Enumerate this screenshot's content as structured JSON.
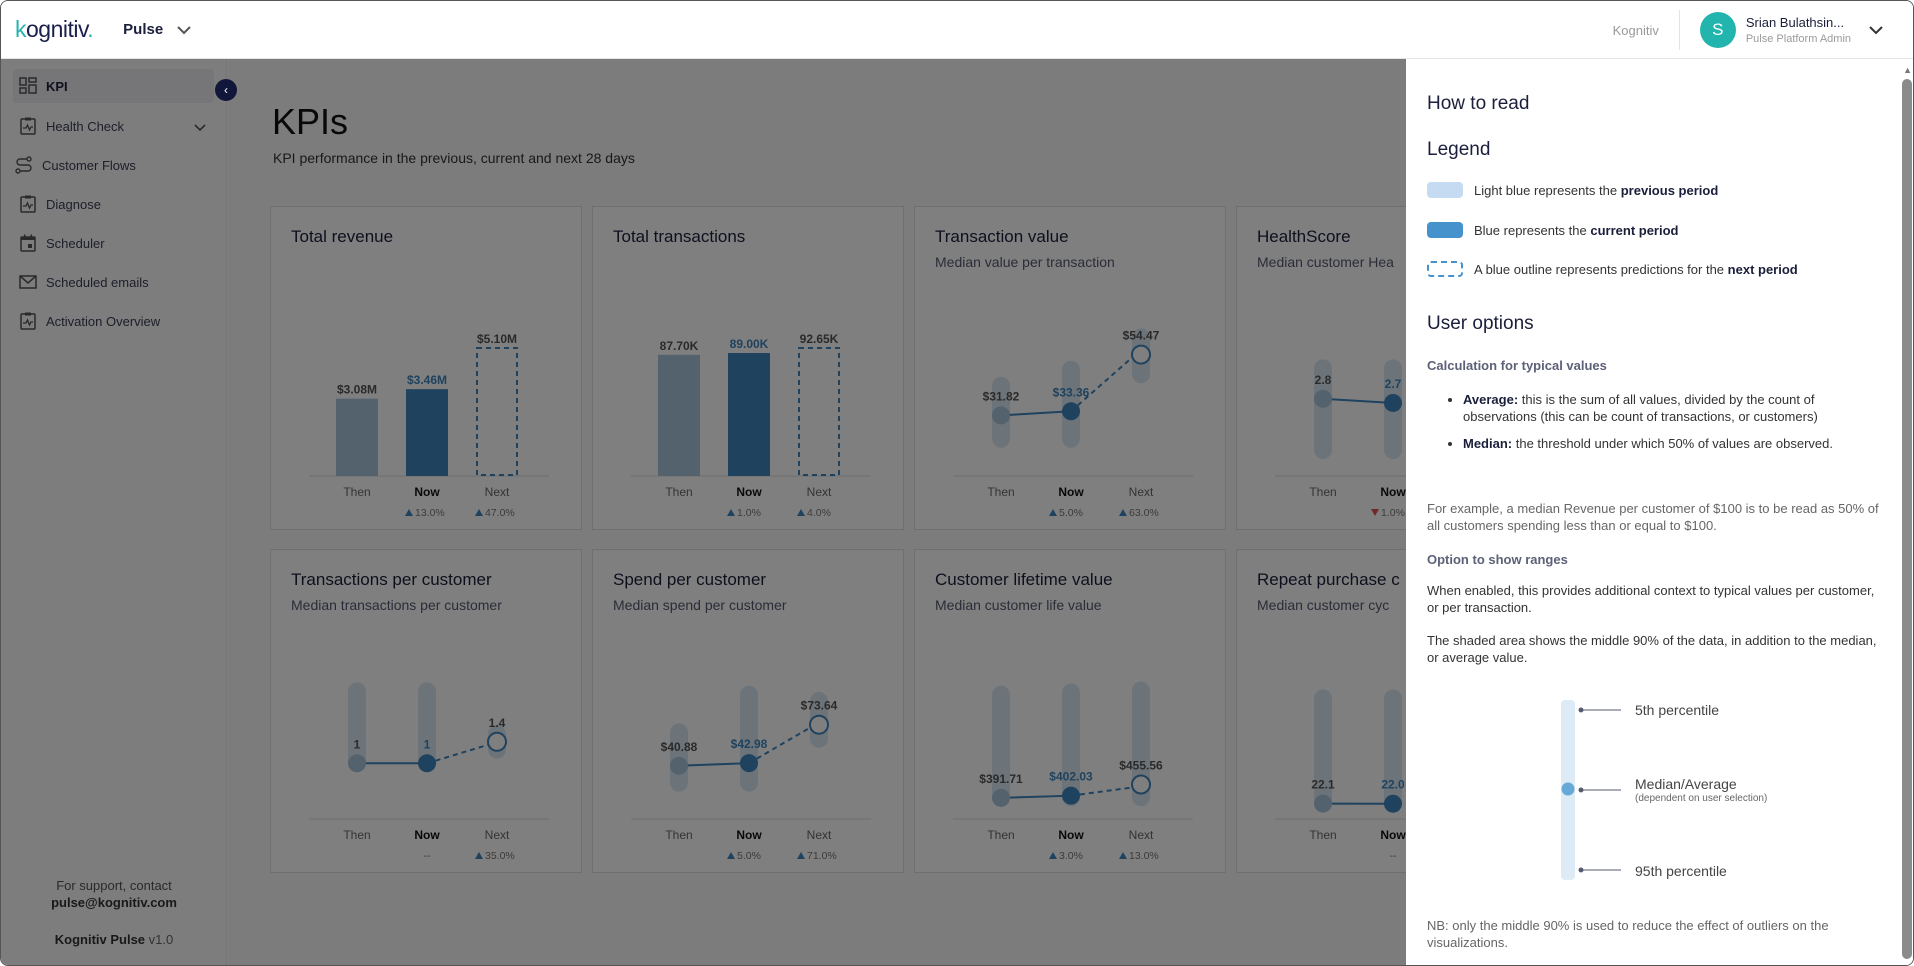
{
  "header": {
    "logo": {
      "k": "k",
      "rest": "ognitiv",
      "dot": "."
    },
    "product": "Pulse",
    "org": "Kognitiv",
    "user": {
      "initial": "S",
      "name": "Srian Bulathsin...",
      "role": "Pulse Platform Admin"
    }
  },
  "sidebar": {
    "items": [
      {
        "label": "KPI",
        "icon": "dashboard-icon",
        "active": true
      },
      {
        "label": "Health Check",
        "icon": "clipboard-pulse-icon",
        "expandable": true
      },
      {
        "label": "Customer Flows",
        "icon": "route-icon"
      },
      {
        "label": "Diagnose",
        "icon": "clipboard-pulse-icon"
      },
      {
        "label": "Scheduler",
        "icon": "calendar-icon"
      },
      {
        "label": "Scheduled emails",
        "icon": "mail-icon"
      },
      {
        "label": "Activation Overview",
        "icon": "clipboard-pulse-icon"
      }
    ],
    "collapse_glyph": "‹",
    "support_text": "For support, contact",
    "support_email": "pulse@kognitiv.com",
    "product_name": "Kognitiv Pulse",
    "version": "v1.0"
  },
  "main": {
    "title": "KPIs",
    "subtitle": "KPI performance in the previous, current and next 28 days"
  },
  "period_labels": {
    "then": "Then",
    "now": "Now",
    "next": "Next"
  },
  "colors": {
    "then": "#a9c4dc",
    "now": "#3e84bd",
    "range": "#dbe8f3",
    "up": "#3e84bd",
    "down": "#d9534f"
  },
  "chart_data": [
    {
      "type": "bar",
      "title": "Total revenue",
      "subtitle": "",
      "categories": [
        "Then",
        "Now",
        "Next"
      ],
      "values": [
        3.08,
        3.46,
        5.1
      ],
      "labels": [
        "$3.08M",
        "$3.46M",
        "$5.10M"
      ],
      "unit": "M USD",
      "changes": {
        "now": {
          "dir": "up",
          "text": "13.0%"
        },
        "next": {
          "dir": "up",
          "text": "47.0%"
        }
      }
    },
    {
      "type": "bar",
      "title": "Total transactions",
      "subtitle": "",
      "categories": [
        "Then",
        "Now",
        "Next"
      ],
      "values": [
        87.7,
        89.0,
        92.65
      ],
      "labels": [
        "87.70K",
        "89.00K",
        "92.65K"
      ],
      "unit": "K",
      "changes": {
        "now": {
          "dir": "up",
          "text": "1.0%"
        },
        "next": {
          "dir": "up",
          "text": "4.0%"
        }
      }
    },
    {
      "type": "line",
      "title": "Transaction value",
      "subtitle": "Median value per transaction",
      "categories": [
        "Then",
        "Now",
        "Next"
      ],
      "values": [
        31.82,
        33.36,
        54.47
      ],
      "labels": [
        "$31.82",
        "$33.36",
        "$54.47"
      ],
      "ranges": [
        [
          22,
          44
        ],
        [
          22,
          50
        ],
        [
          46,
          62
        ]
      ],
      "ylim": [
        10,
        80
      ],
      "changes": {
        "now": {
          "dir": "up",
          "text": "5.0%"
        },
        "next": {
          "dir": "up",
          "text": "63.0%"
        }
      }
    },
    {
      "type": "line",
      "title": "HealthScore",
      "subtitle": "Median customer Hea",
      "categories": [
        "Then",
        "Now"
      ],
      "values": [
        2.8,
        2.7
      ],
      "labels": [
        "2.8",
        "2.7"
      ],
      "ranges": [
        [
          1.5,
          3.6
        ],
        [
          1.5,
          3.6
        ]
      ],
      "ylim": [
        1.0,
        5.5
      ],
      "changes": {
        "now": {
          "dir": "down",
          "text": "1.0%"
        }
      }
    },
    {
      "type": "line",
      "title": "Transactions per customer",
      "subtitle": "Median transactions per customer",
      "categories": [
        "Then",
        "Now",
        "Next"
      ],
      "values": [
        1,
        1,
        1.4
      ],
      "labels": [
        "1",
        "1",
        "1.4"
      ],
      "ranges": [
        [
          1,
          2.4
        ],
        [
          1,
          2.4
        ],
        [
          1.2,
          1.6
        ]
      ],
      "ylim": [
        0,
        3.5
      ],
      "changes": {
        "now": {
          "dir": "none",
          "text": "--"
        },
        "next": {
          "dir": "up",
          "text": "35.0%"
        }
      }
    },
    {
      "type": "line",
      "title": "Spend per customer",
      "subtitle": "Median spend per customer",
      "categories": [
        "Then",
        "Now",
        "Next"
      ],
      "values": [
        40.88,
        42.98,
        73.64
      ],
      "labels": [
        "$40.88",
        "$42.98",
        "$73.64"
      ],
      "ranges": [
        [
          25,
          70
        ],
        [
          25,
          100
        ],
        [
          60,
          95
        ]
      ],
      "ylim": [
        0,
        150
      ],
      "changes": {
        "now": {
          "dir": "up",
          "text": "5.0%"
        },
        "next": {
          "dir": "up",
          "text": "71.0%"
        }
      }
    },
    {
      "type": "line",
      "title": "Customer lifetime value",
      "subtitle": "Median customer life value",
      "categories": [
        "Then",
        "Now",
        "Next"
      ],
      "values": [
        391.71,
        402.03,
        455.56
      ],
      "labels": [
        "$391.71",
        "$402.03",
        "$455.56"
      ],
      "ranges": [
        [
          380,
          900
        ],
        [
          380,
          910
        ],
        [
          380,
          920
        ]
      ],
      "ylim": [
        300,
        1200
      ],
      "changes": {
        "now": {
          "dir": "up",
          "text": "3.0%"
        },
        "next": {
          "dir": "up",
          "text": "13.0%"
        }
      }
    },
    {
      "type": "line",
      "title": "Repeat purchase c",
      "subtitle": "Median customer cyc",
      "categories": [
        "Then",
        "Now"
      ],
      "values": [
        22.1,
        22.0
      ],
      "labels": [
        "22.1",
        "22.0"
      ],
      "ranges": [
        [
          20,
          120
        ],
        [
          20,
          120
        ]
      ],
      "ylim": [
        10,
        180
      ],
      "changes": {
        "now": {
          "dir": "none",
          "text": "--"
        }
      }
    }
  ],
  "panel": {
    "title": "How to read",
    "legend_title": "Legend",
    "legend": [
      {
        "swatch": "light",
        "text": "Light blue represents the ",
        "bold": "previous period"
      },
      {
        "swatch": "blue",
        "text": "Blue represents the ",
        "bold": "current period"
      },
      {
        "swatch": "outline",
        "text": "A blue outline represents predictions for the ",
        "bold": "next period"
      }
    ],
    "user_options_title": "User options",
    "calc_title": "Calculation for typical values",
    "calc_items": [
      {
        "bold": "Average:",
        "text": " this is the sum of all values, divided by the count of observations (this can be count of transactions, or customers)"
      },
      {
        "bold": "Median:",
        "text": " the threshold under which 50% of values are observed."
      }
    ],
    "calc_example": "For example, a median Revenue per customer of $100 is to be read as 50% of all customers spending less than or equal to $100.",
    "ranges_title": "Option to show ranges",
    "ranges_text1": "When enabled, this provides additional context to typical values per customer, or per transaction.",
    "ranges_text2": "The shaded area shows the middle 90% of the data, in addition to the median, or average value.",
    "diagram": {
      "p5": "5th percentile",
      "median": "Median/Average",
      "median_note": "(dependent on user selection)",
      "p95": "95th percentile"
    },
    "nb": "NB: only the middle 90% is used to reduce the effect of outliers on the visualizations."
  }
}
